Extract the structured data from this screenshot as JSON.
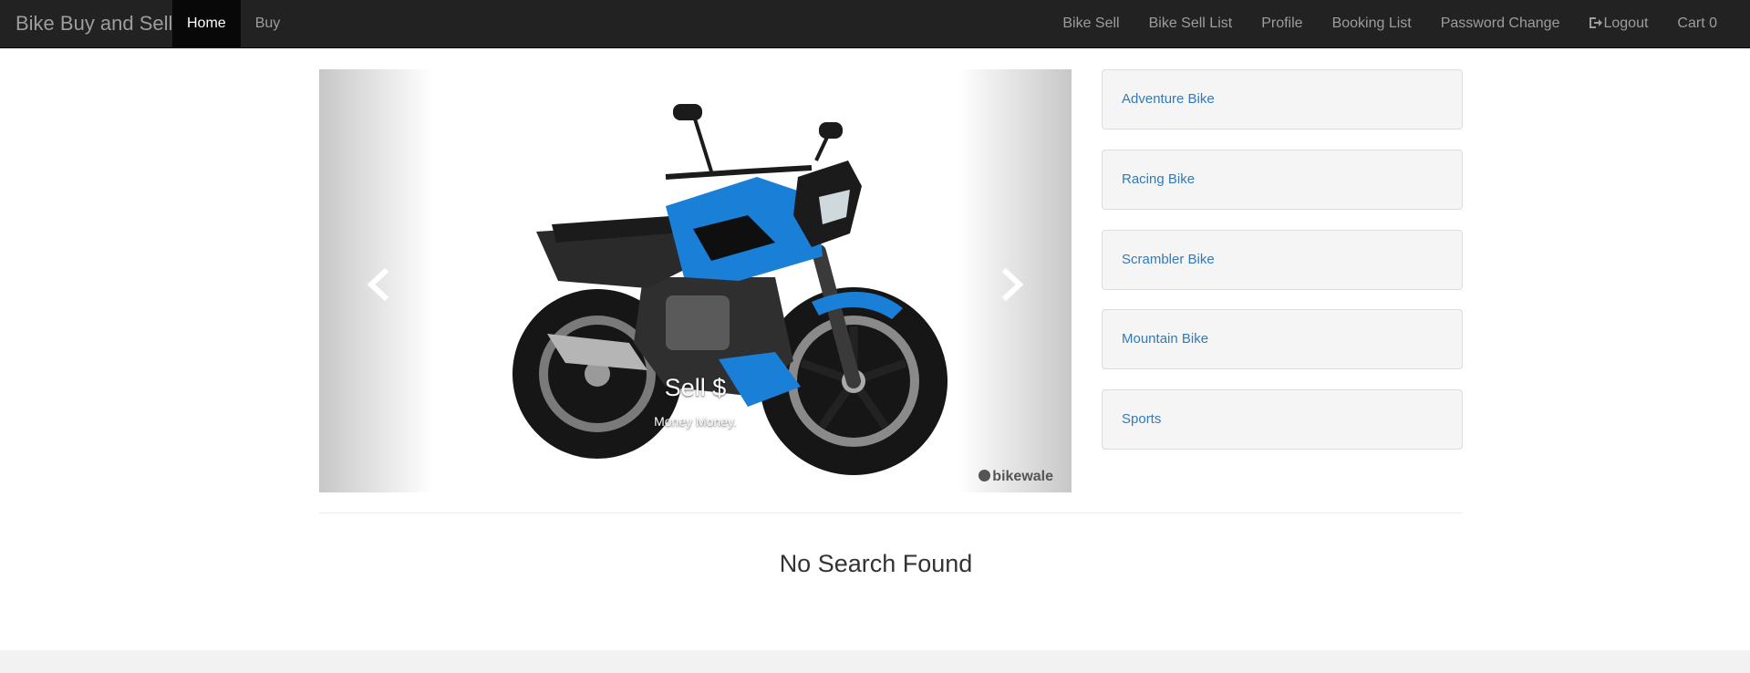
{
  "navbar": {
    "brand": "Bike Buy and Sell",
    "left_items": [
      {
        "label": "Home",
        "active": true
      },
      {
        "label": "Buy",
        "active": false
      }
    ],
    "right_items": [
      {
        "label": "Bike Sell"
      },
      {
        "label": "Bike Sell List"
      },
      {
        "label": "Profile"
      },
      {
        "label": "Booking List"
      },
      {
        "label": "Password Change"
      },
      {
        "label": "Logout",
        "icon": "logout-icon"
      },
      {
        "label": "Cart 0"
      }
    ]
  },
  "carousel": {
    "caption_title": "Sell $",
    "caption_text": "Money Money.",
    "watermark": "bikewale",
    "prev_icon": "chevron-left-icon",
    "next_icon": "chevron-right-icon"
  },
  "categories": [
    {
      "label": "Adventure Bike"
    },
    {
      "label": "Racing Bike"
    },
    {
      "label": "Scrambler Bike"
    },
    {
      "label": "Mountain Bike"
    },
    {
      "label": "Sports"
    }
  ],
  "message": "No Search Found",
  "colors": {
    "navbar_bg": "#222222",
    "nav_text": "#9d9d9d",
    "active_bg": "#080808",
    "link": "#337ab7",
    "bike_blue": "#1a7fd6"
  }
}
